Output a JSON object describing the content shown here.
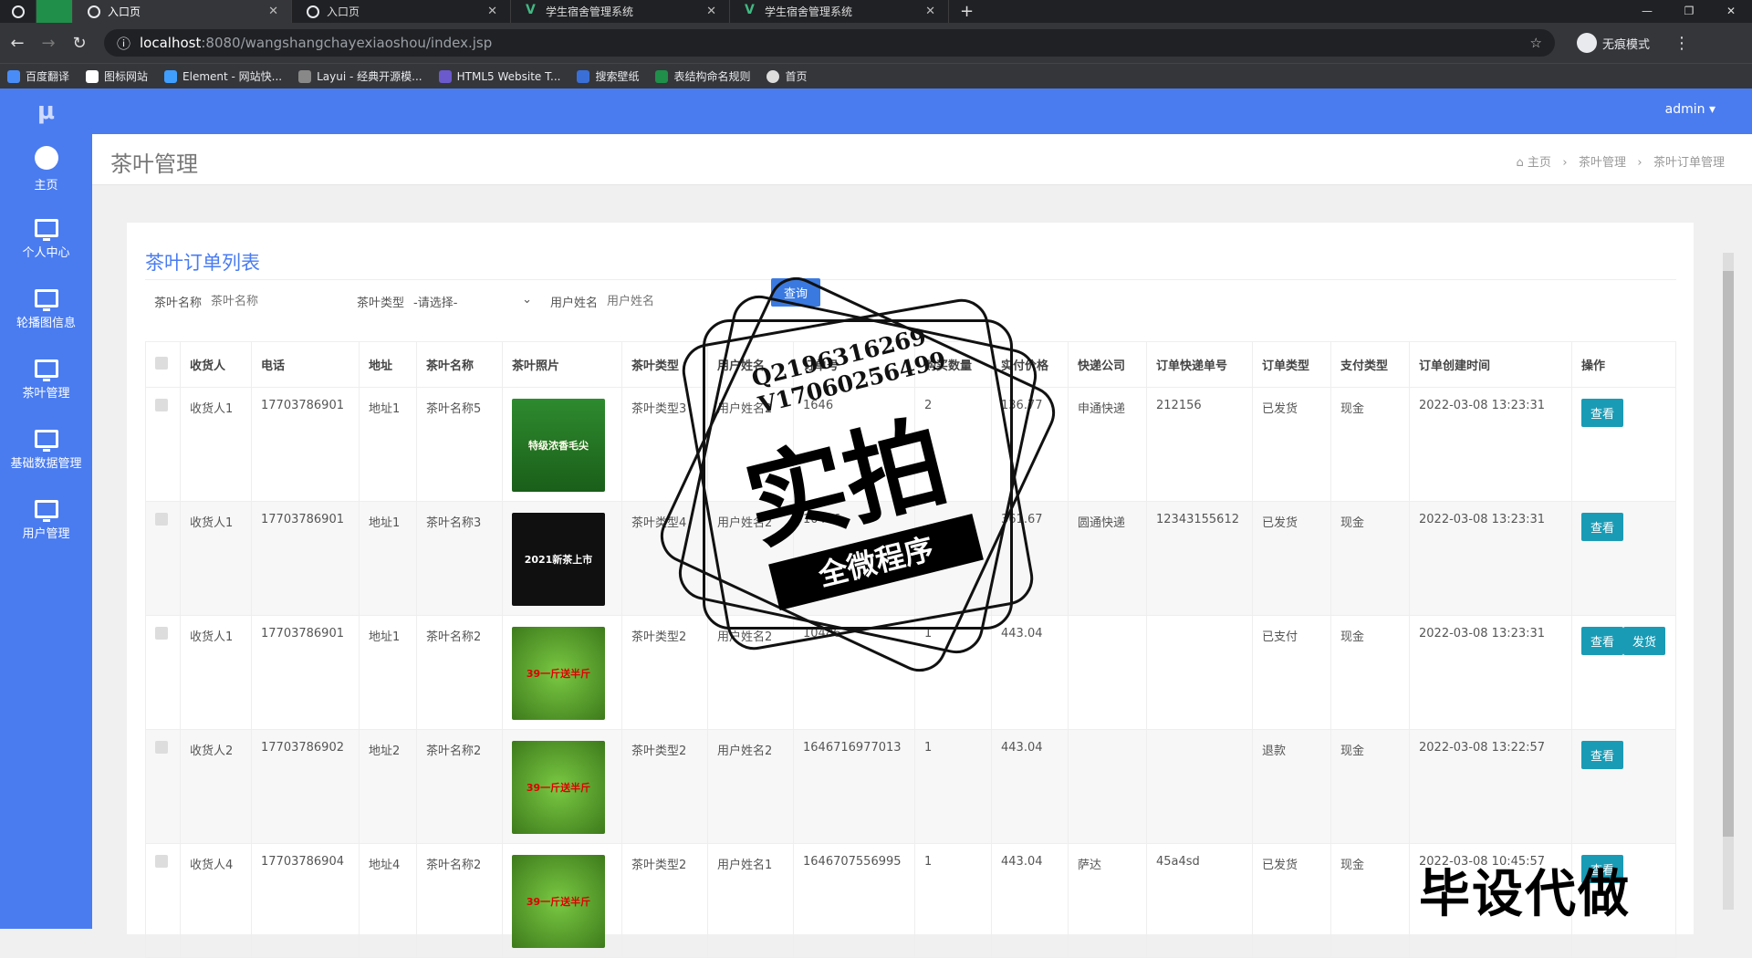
{
  "browser": {
    "tabs": [
      {
        "label": "",
        "icon": "chrome-icon"
      },
      {
        "label": "入口页",
        "active": true
      },
      {
        "label": "入口页"
      },
      {
        "label": "学生宿舍管理系统"
      },
      {
        "label": "学生宿舍管理系统"
      }
    ],
    "url_host": "localhost",
    "url_rest": ":8080/wangshangchayexiaoshou/index.jsp",
    "incognito": "无痕模式",
    "bookmarks": [
      "百度翻译",
      "图标网站",
      "Element - 网站快...",
      "Layui - 经典开源模...",
      "HTML5 Website T...",
      "搜索壁纸",
      "表结构命名规则",
      "首页"
    ]
  },
  "app": {
    "user": "admin ▾",
    "sidebar": [
      "主页",
      "个人中心",
      "轮播图信息",
      "茶叶管理",
      "基础数据管理",
      "用户管理"
    ],
    "page_title": "茶叶管理",
    "breadcrumb": [
      "主页",
      "茶叶管理",
      "茶叶订单管理"
    ],
    "panel_title": "茶叶订单列表",
    "search": {
      "name_label": "茶叶名称",
      "name_placeholder": "茶叶名称",
      "type_label": "茶叶类型",
      "type_value": "-请选择-",
      "user_label": "用户姓名",
      "user_placeholder": "用户姓名",
      "query": "查询"
    },
    "columns": [
      "收货人",
      "电话",
      "地址",
      "茶叶名称",
      "茶叶照片",
      "茶叶类型",
      "用户姓名",
      "订单号",
      "购买数量",
      "实付价格",
      "快递公司",
      "订单快递单号",
      "订单类型",
      "支付类型",
      "订单创建时间",
      "操作"
    ],
    "rows": [
      {
        "receiver": "收货人1",
        "phone": "17703786901",
        "addr": "地址1",
        "tea": "茶叶名称5",
        "photo": "特级浓香毛尖",
        "type": "茶叶类型3",
        "user": "用户姓名2",
        "order": "1646",
        "qty": "2",
        "price": "136.77",
        "express": "申通快递",
        "track": "212156",
        "status": "已发货",
        "pay": "现金",
        "time": "2022-03-08 13:23:31",
        "actions": [
          "查看"
        ]
      },
      {
        "receiver": "收货人1",
        "phone": "17703786901",
        "addr": "地址1",
        "tea": "茶叶名称3",
        "photo": "2021新茶上市",
        "type": "茶叶类型4",
        "user": "用户姓名2",
        "order": "10486",
        "qty": "",
        "price": "361.67",
        "express": "圆通快递",
        "track": "12343155612",
        "status": "已发货",
        "pay": "现金",
        "time": "2022-03-08 13:23:31",
        "actions": [
          "查看"
        ]
      },
      {
        "receiver": "收货人1",
        "phone": "17703786901",
        "addr": "地址1",
        "tea": "茶叶名称2",
        "photo": "39一斤送半斤",
        "type": "茶叶类型2",
        "user": "用户姓名2",
        "order": "10486",
        "qty": "1",
        "price": "443.04",
        "express": "",
        "track": "",
        "status": "已支付",
        "pay": "现金",
        "time": "2022-03-08 13:23:31",
        "actions": [
          "查看",
          "发货"
        ]
      },
      {
        "receiver": "收货人2",
        "phone": "17703786902",
        "addr": "地址2",
        "tea": "茶叶名称2",
        "photo": "39一斤送半斤",
        "type": "茶叶类型2",
        "user": "用户姓名2",
        "order": "1646716977013",
        "qty": "1",
        "price": "443.04",
        "express": "",
        "track": "",
        "status": "退款",
        "pay": "现金",
        "time": "2022-03-08 13:22:57",
        "actions": [
          "查看"
        ]
      },
      {
        "receiver": "收货人4",
        "phone": "17703786904",
        "addr": "地址4",
        "tea": "茶叶名称2",
        "photo": "39一斤送半斤",
        "type": "茶叶类型2",
        "user": "用户姓名1",
        "order": "1646707556995",
        "qty": "1",
        "price": "443.04",
        "express": "萨达",
        "track": "45a4sd",
        "status": "已发货",
        "pay": "现金",
        "time": "2022-03-08 10:45:57",
        "actions": [
          "查看"
        ]
      }
    ]
  },
  "overlay": {
    "qq": "Q2196316269",
    "vx": "V17060256499",
    "stamp_big": "实拍",
    "stamp_ribbon": "全微程序",
    "watermark": "毕设代做"
  }
}
